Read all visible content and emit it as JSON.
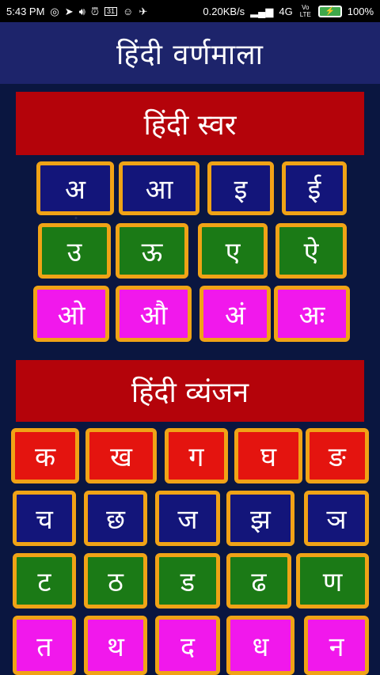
{
  "status_bar": {
    "time": "5:43 PM",
    "speed": "0.20KB/s",
    "network": "4G",
    "volte": "Vo LTE",
    "battery": "100%",
    "icons": [
      "whatsapp-icon",
      "send-icon",
      "volume-icon",
      "alarm-icon",
      "calendar-icon",
      "cat-icon",
      "satellite-icon",
      "signal-icon",
      "battery-icon"
    ],
    "calendar_day": "31"
  },
  "app_bar": {
    "title": "हिंदी वर्णमाला"
  },
  "vowels_section": {
    "title": "हिंदी स्वर",
    "rows": [
      [
        "अ",
        "आ",
        "इ",
        "ई"
      ],
      [
        "उ",
        "ऊ",
        "ए",
        "ऐ"
      ],
      [
        "ओ",
        "औ",
        "अं",
        "अः"
      ]
    ]
  },
  "consonants_section": {
    "title": "हिंदी व्यंजन",
    "rows": [
      [
        "क",
        "ख",
        "ग",
        "घ",
        "ङ"
      ],
      [
        "च",
        "छ",
        "ज",
        "झ",
        "ञ"
      ],
      [
        "ट",
        "ठ",
        "ड",
        "ढ",
        "ण"
      ],
      [
        "त",
        "थ",
        "द",
        "ध",
        "न"
      ]
    ]
  },
  "colors": {
    "tile_border": "#f0a316",
    "banner": "#b4030a",
    "app_bar": "#1d246b",
    "blue_tile": "#13157a",
    "green_tile": "#1b7a16",
    "pink_tile": "#f118ec",
    "red_tile": "#e4140f"
  }
}
